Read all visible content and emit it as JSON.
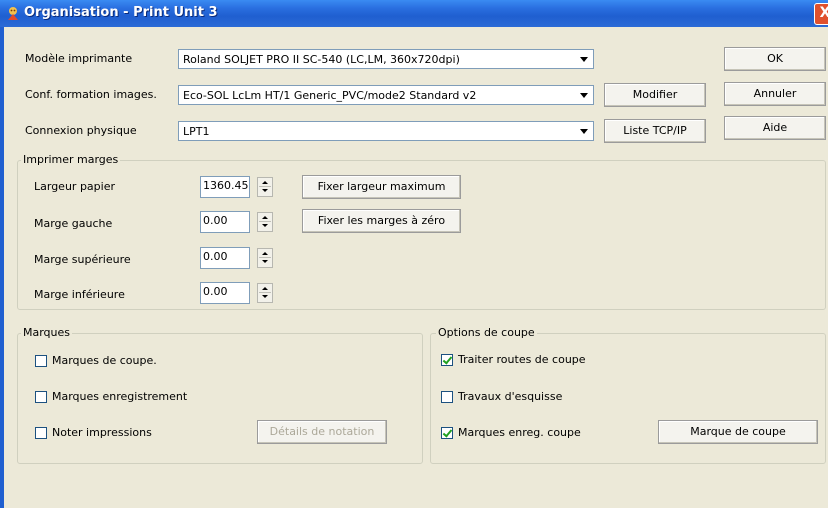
{
  "window": {
    "title": "Organisation - Print Unit 3",
    "close_glyph": "X"
  },
  "form": {
    "printer_model": {
      "label": "Modèle imprimante",
      "value": "Roland  SOLJET PRO II SC-540 (LC,LM, 360x720dpi)"
    },
    "image_config": {
      "label": "Conf. formation images.",
      "value": "Eco-SOL LcLm HT/1 Generic_PVC/mode2 Standard v2"
    },
    "connection": {
      "label": "Connexion physique",
      "value": "LPT1"
    }
  },
  "buttons": {
    "ok": "OK",
    "cancel": "Annuler",
    "help": "Aide",
    "modify": "Modifier",
    "tcp_list": "Liste TCP/IP",
    "max_width": "Fixer largeur maximum",
    "zero_margins": "Fixer les marges à zéro",
    "notation_details": "Détails de notation",
    "cut_mark": "Marque de coupe"
  },
  "margins": {
    "title": "Imprimer marges",
    "paper_width": {
      "label": "Largeur papier",
      "value": "1360.45"
    },
    "left_margin": {
      "label": "Marge gauche",
      "value": "0.00"
    },
    "top_margin": {
      "label": "Marge supérieure",
      "value": "0.00"
    },
    "bottom_margin": {
      "label": "Marge inférieure",
      "value": "0.00"
    }
  },
  "marks": {
    "title": "Marques",
    "items": [
      {
        "label": "Marques de coupe.",
        "checked": false
      },
      {
        "label": "Marques enregistrement",
        "checked": false
      },
      {
        "label": "Noter impressions",
        "checked": false
      }
    ]
  },
  "cut_options": {
    "title": "Options de coupe",
    "items": [
      {
        "label": "Traiter routes de coupe",
        "checked": true
      },
      {
        "label": "Travaux d'esquisse",
        "checked": false
      },
      {
        "label": "Marques enreg. coupe",
        "checked": true
      }
    ]
  },
  "colors": {
    "titlebar": "#2a6fe0",
    "dialog_bg": "#ece9d8",
    "close": "#e0512e"
  }
}
